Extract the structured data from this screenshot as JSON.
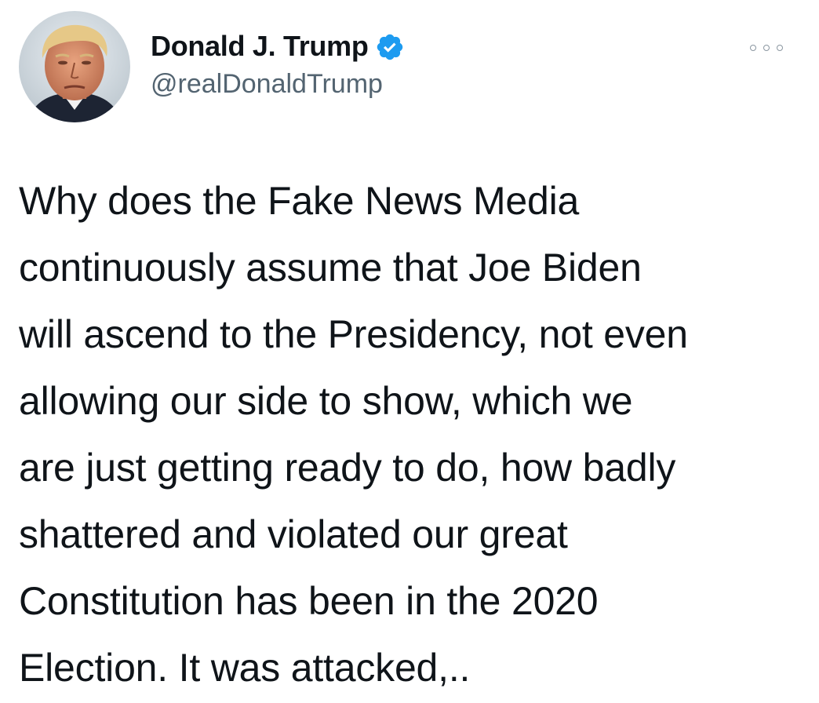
{
  "tweet": {
    "author": {
      "display_name": "Donald J. Trump",
      "handle": "@realDonaldTrump",
      "verified": true,
      "verified_color": "#1d9bf0",
      "avatar_icon": "profile-photo"
    },
    "more_menu_icon": "more-options-icon",
    "text_lines": [
      "Why does the Fake News Media",
      "continuously assume that Joe Biden",
      "will ascend to the Presidency, not even",
      "allowing our side to show, which we",
      "are just getting ready to do, how badly",
      "shattered and violated our great",
      "Constitution has been in the 2020",
      "Election. It was attacked,.."
    ]
  }
}
